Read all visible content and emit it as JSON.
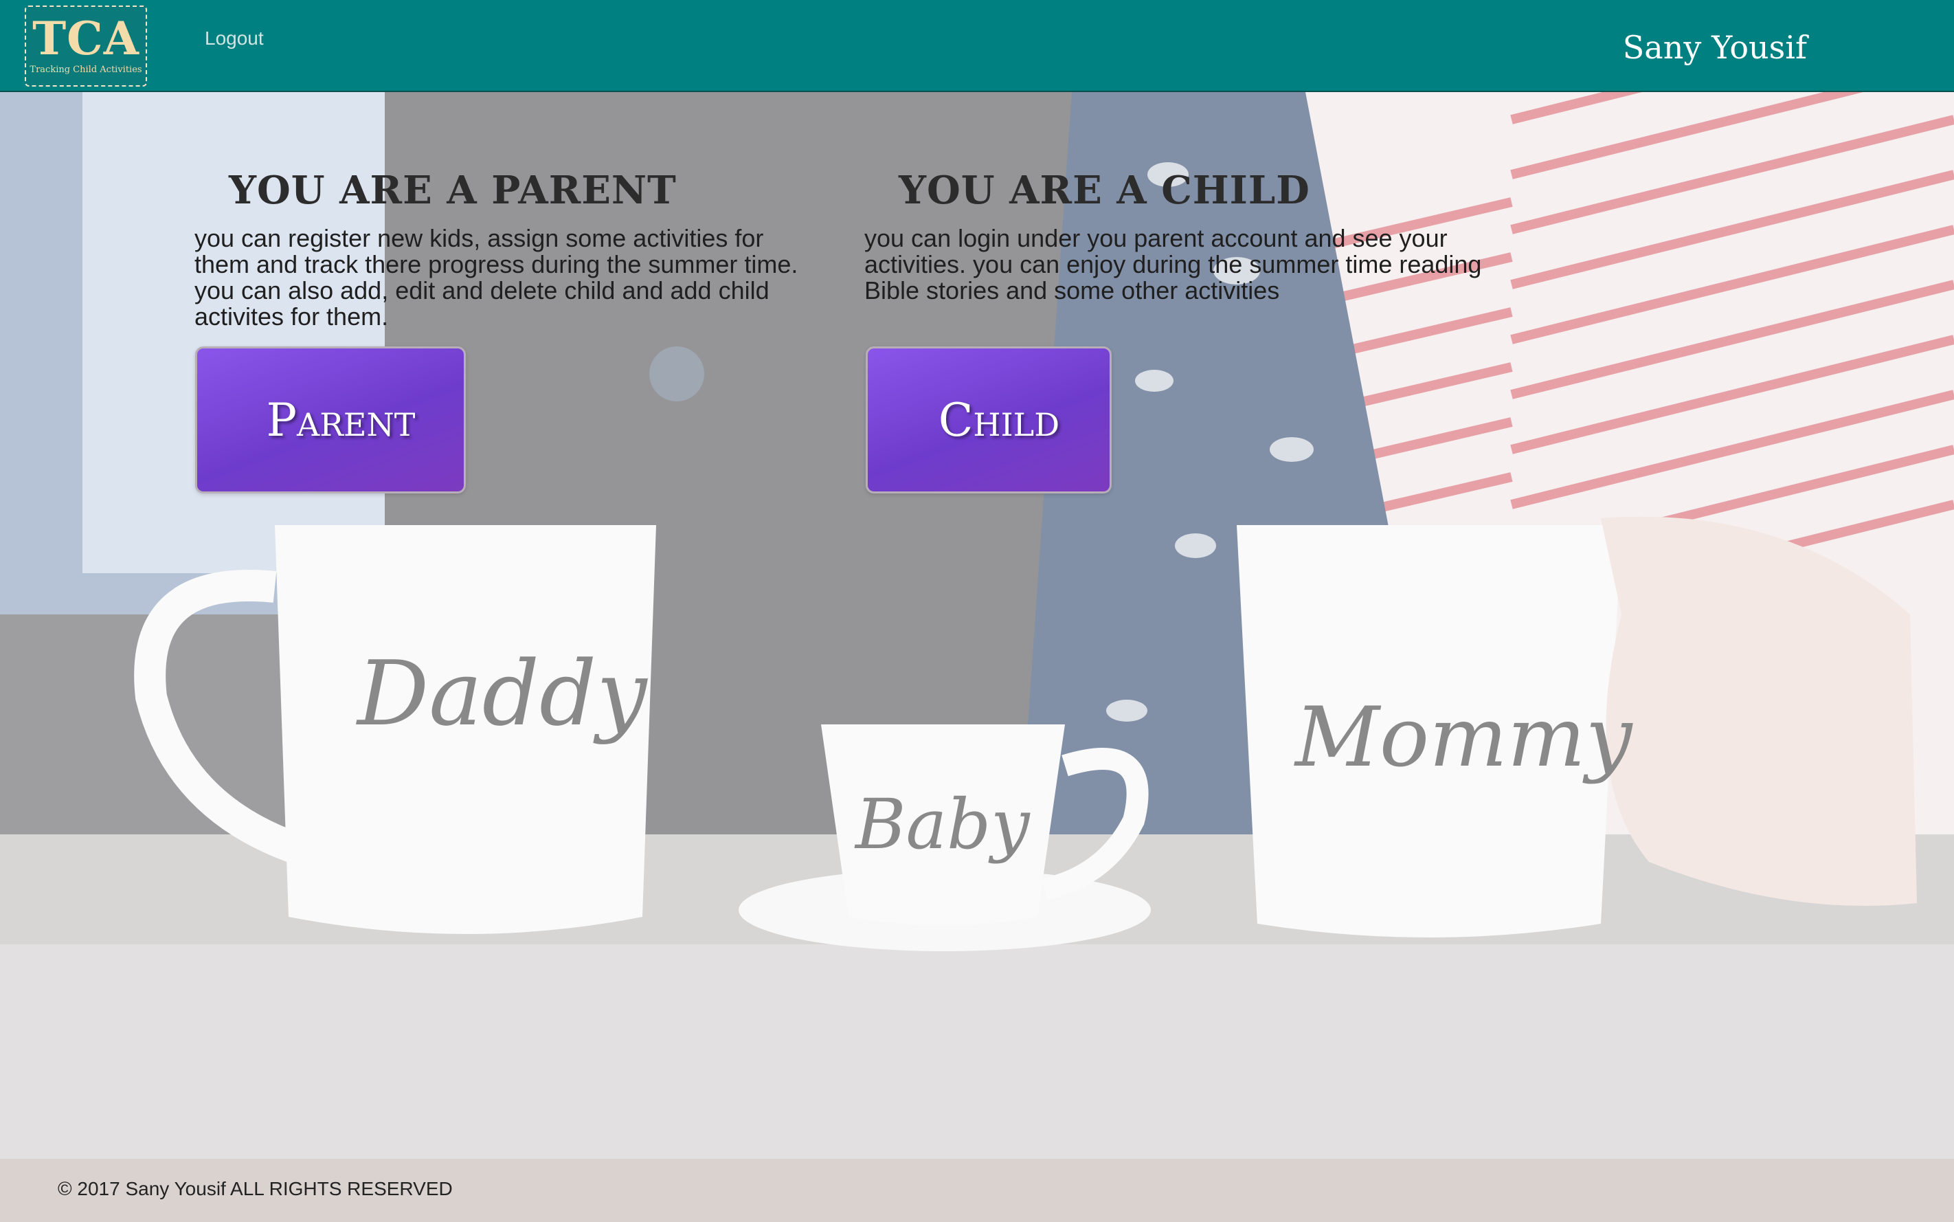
{
  "header": {
    "logo_text": "TCA",
    "logo_tagline": "Tracking Child Activities",
    "logout_label": "Logout",
    "username": "Sany Yousif"
  },
  "hero": {
    "image_caption_words": [
      "Daddy",
      "Baby",
      "Mommy"
    ]
  },
  "parent": {
    "heading": "YOU ARE A PARENT",
    "description": "you can register new kids, assign some activities for them and track there progress during the summer time. you can also add, edit and delete child and add child activites for them.",
    "button_label": "Parent"
  },
  "child": {
    "heading": "YOU ARE A CHILD",
    "description": "you can login under you parent account and see your activities. you can enjoy during the summer time reading Bible stories and some other activities",
    "button_label": "Child"
  },
  "footer": {
    "copyright": "© 2017 Sany Yousif ALL RIGHTS RESERVED"
  },
  "colors": {
    "header_bg": "#008080",
    "button_bg": "#7a48dc",
    "footer_bg": "#d9d2cf"
  }
}
